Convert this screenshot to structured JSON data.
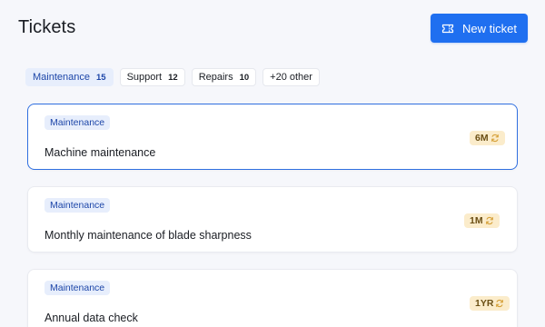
{
  "header": {
    "title": "Tickets",
    "new_ticket_label": "New ticket",
    "new_ticket_icon": "ticket-icon"
  },
  "filters": [
    {
      "label": "Maintenance",
      "count": "15",
      "active": true
    },
    {
      "label": "Support",
      "count": "12",
      "active": false
    },
    {
      "label": "Repairs",
      "count": "10",
      "active": false
    },
    {
      "label": "+20 other",
      "count": "",
      "active": false
    }
  ],
  "tickets": [
    {
      "tag": "Maintenance",
      "title": "Machine maintenance",
      "recurrence": "6M",
      "recurrence_icon": "refresh-icon",
      "selected": true
    },
    {
      "tag": "Maintenance",
      "title": "Monthly maintenance of blade sharpness",
      "recurrence": "1M",
      "recurrence_icon": "refresh-icon",
      "selected": false
    },
    {
      "tag": "Maintenance",
      "title": "Annual data check",
      "recurrence": "1YR",
      "recurrence_icon": "refresh-icon",
      "selected": false
    }
  ],
  "colors": {
    "accent": "#1f6ff0",
    "tag_bg": "#e7eefc",
    "tag_text": "#1d46a8",
    "recurrence_bg": "#fbeccb",
    "recurrence_icon": "#d6a13a"
  }
}
